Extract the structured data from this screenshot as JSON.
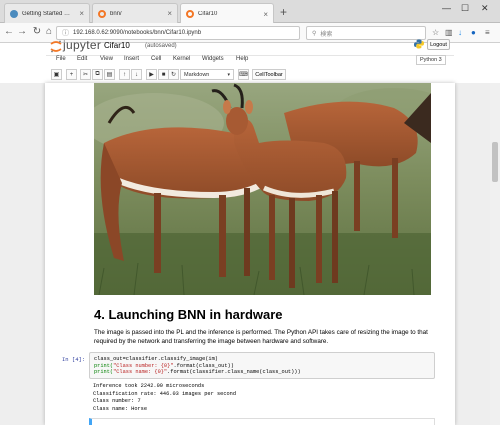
{
  "browser": {
    "tabs": [
      {
        "label": "Getting Started — Python ...",
        "active": false,
        "favicon_color": "#4b8bbe"
      },
      {
        "label": "bnn/",
        "active": false,
        "favicon_color": "#f37726"
      },
      {
        "label": "Cifar10",
        "active": true,
        "favicon_color": "#f37726"
      }
    ],
    "new_tab_symbol": "+",
    "close_symbol": "×",
    "window_controls": [
      "—",
      "☐",
      "✕"
    ],
    "url": "192.168.0.62:9090/notebooks/bnn/Cifar10.ipynb",
    "search_placeholder": "検索"
  },
  "jupyter": {
    "logo_text": "jupyter",
    "notebook_title": "Cifar10",
    "autosave_status": "(autosaved)",
    "logout_label": "Logout",
    "menu": [
      "File",
      "Edit",
      "View",
      "Insert",
      "Cell",
      "Kernel",
      "Widgets",
      "Help"
    ],
    "kernel": "Python 3",
    "toolbar_icons": [
      "save-icon",
      "add-cell-icon",
      "cut-icon",
      "copy-icon",
      "paste-icon",
      "move-up-icon",
      "move-down-icon",
      "run-icon",
      "stop-icon",
      "restart-icon"
    ],
    "cell_type": "Markdown",
    "celltoolbar_label": "CellToolbar"
  },
  "notebook": {
    "heading": "4. Launching BNN in hardware",
    "paragraph": "The image is passed into the PL and the inference is performed. The Python API takes care of resizing the image to that required by the network and transferring the image between hardware and software.",
    "prompt": "In [4]:",
    "code_lines": {
      "l1": "class_out=classifier.classify_image(im)",
      "l2a": "print(",
      "l2s": "\"Class number: {0}\"",
      "l2b": ".format(class_out))",
      "l3a": "print(",
      "l3s": "\"Class name: {0}\"",
      "l3b": ".format(classifier.class_name(class_out)))"
    },
    "output": [
      "Inference took 2242.00 microseconds",
      "Classification rate: 446.03 images per second",
      "Class number: 7",
      "Class name: Horse"
    ]
  },
  "colors": {
    "jupyter_orange": "#f37726",
    "prompt_blue": "#303f9f",
    "string_red": "#ba2121"
  }
}
